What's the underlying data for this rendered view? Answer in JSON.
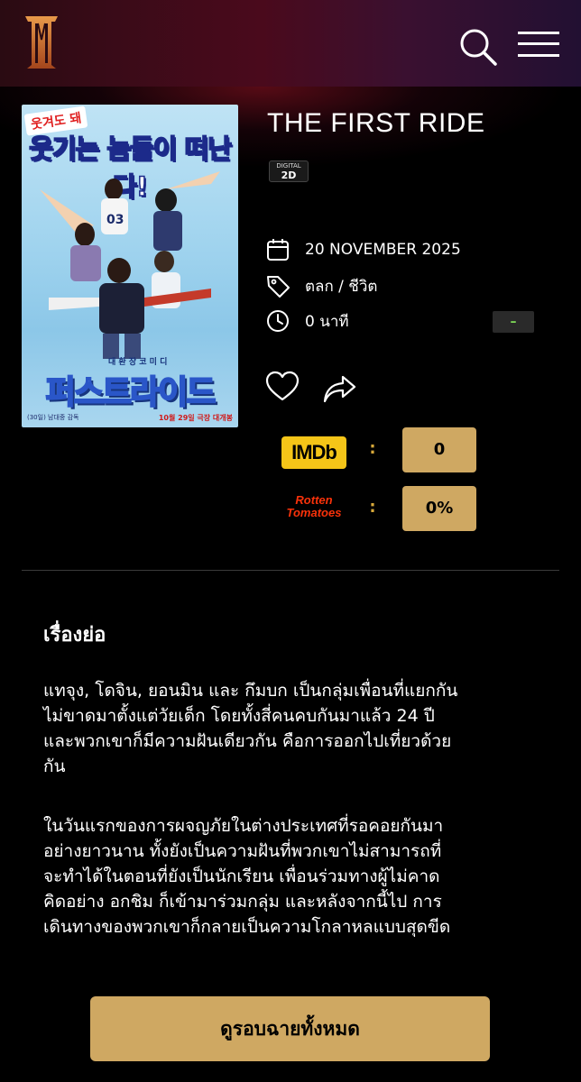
{
  "header": {
    "logo": "major-cineplex-logo",
    "icons": [
      "search-icon",
      "hamburger-menu-icon"
    ],
    "background_colors": [
      "#2a0b12",
      "#4a0a1c",
      "#221032"
    ]
  },
  "poster": {
    "tag_text": "웃겨도 돼",
    "headline_text": "웃기는 놈들이 떠난다!",
    "title_text": "퍼스트라이드",
    "subtitle_text": "대 환 장 코 미 디",
    "jersey_text": "03",
    "credits_text": "(30일) 남대중 감독",
    "release_text": "10월 29일 극장 대개봉"
  },
  "movie": {
    "title": "THE FIRST RIDE",
    "format_small": "DIGITAL",
    "format_big": "2D",
    "release_date": "20 NOVEMBER 2025",
    "genre": "ตลก / ชีวิต",
    "duration": "0 นาที",
    "rating": "–",
    "rating_color": "#7ed957"
  },
  "scores": {
    "imdb_label": "IMDb",
    "imdb_value": "0",
    "rt_label_line1": "Rotten",
    "rt_label_line2": "Tomatoes",
    "rt_value": "0%",
    "separator": ":",
    "accent_color": "#cfa862"
  },
  "synopsis": {
    "heading": "เรื่องย่อ",
    "paragraph1_lines": [
      "แทจุง, โดจิน, ยอนมิน และ กึมบก เป็นกลุ่มเพื่อนที่แยกกัน",
      "ไม่ขาดมาตั้งแต่วัยเด็ก โดยทั้งสี่คนคบกันมาแล้ว 24 ปี",
      "และพวกเขาก็มีความฝันเดียวกัน คือการออกไปเที่ยวด้วย",
      "กัน"
    ],
    "paragraph2_lines": [
      "ในวันแรกของการผจญภัยในต่างประเทศที่รอคอยกันมา",
      "อย่างยาวนาน ทั้งยังเป็นความฝันที่พวกเขาไม่สามารถที่",
      "จะทำได้ในตอนที่ยังเป็นนักเรียน เพื่อนร่วมทางผู้ไม่คาด",
      "คิดอย่าง อกชิม ก็เข้ามาร่วมกลุ่ม และหลังจากนี้ไป การ",
      "เดินทางของพวกเขาก็กลายเป็นความโกลาหลแบบสุดขีด"
    ]
  },
  "actions": {
    "showtimes_button": "ดูรอบฉายทั้งหมด",
    "favorite_icon": "heart-icon",
    "share_icon": "share-icon"
  }
}
